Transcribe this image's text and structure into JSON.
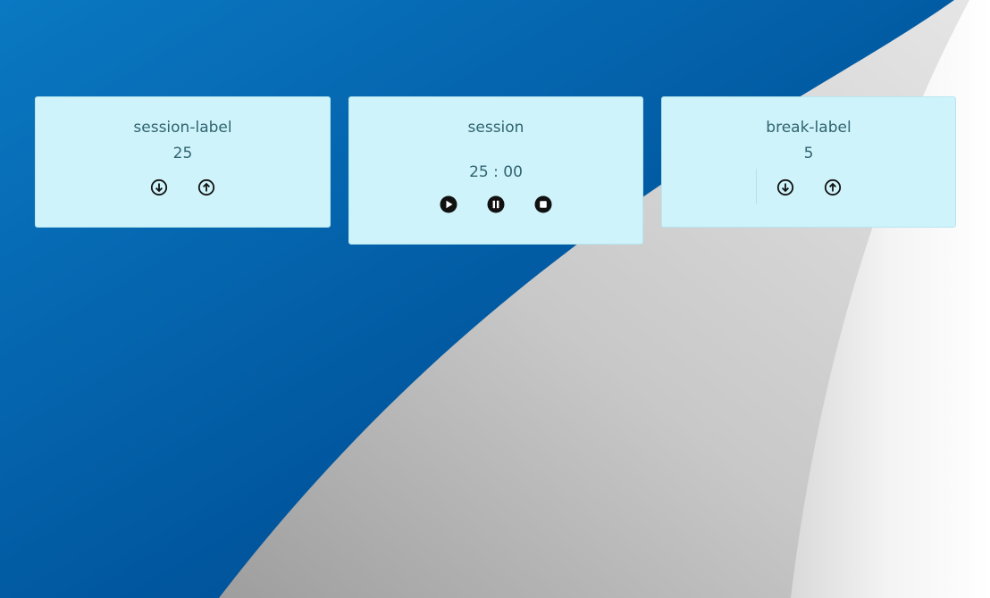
{
  "session_label_card": {
    "title": "session-label",
    "value": "25",
    "decrement_icon": "arrow-circle-down-icon",
    "increment_icon": "arrow-circle-up-icon"
  },
  "timer_card": {
    "title": "session",
    "time": "25 : 00",
    "play_icon": "play-icon",
    "pause_icon": "pause-icon",
    "stop_icon": "stop-icon"
  },
  "break_label_card": {
    "title": "break-label",
    "value": "5",
    "decrement_icon": "arrow-circle-down-icon",
    "increment_icon": "arrow-circle-up-icon"
  },
  "colors": {
    "card_background": "#cff3fa",
    "card_text": "#2f6470",
    "background_blue": "#0060a8",
    "icon_color": "#111111"
  }
}
